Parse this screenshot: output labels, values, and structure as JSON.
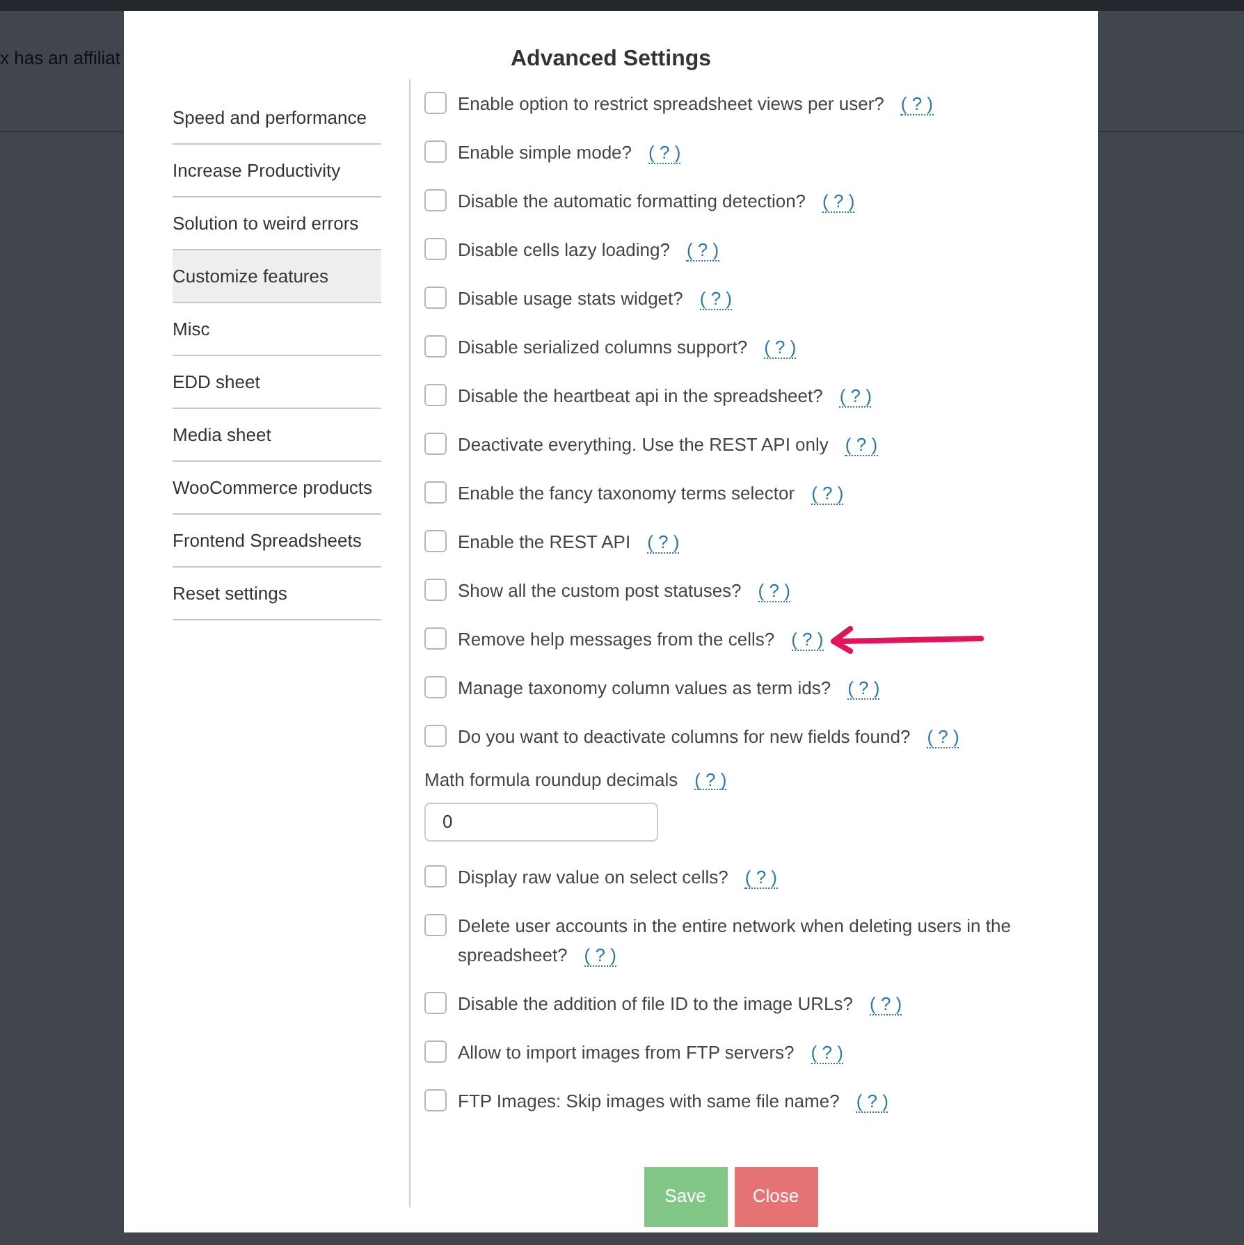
{
  "background": {
    "text": "x has an affiliat"
  },
  "dialog": {
    "title": "Advanced Settings",
    "sidebar": {
      "items": [
        {
          "label": "Speed and performance",
          "selected": false
        },
        {
          "label": "Increase Productivity",
          "selected": false
        },
        {
          "label": "Solution to weird errors",
          "selected": false
        },
        {
          "label": "Customize features",
          "selected": true
        },
        {
          "label": "Misc",
          "selected": false
        },
        {
          "label": "EDD sheet",
          "selected": false
        },
        {
          "label": "Media sheet",
          "selected": false
        },
        {
          "label": "WooCommerce products",
          "selected": false
        },
        {
          "label": "Frontend Spreadsheets",
          "selected": false
        },
        {
          "label": "Reset settings",
          "selected": false
        }
      ]
    },
    "options": [
      {
        "kind": "checkbox",
        "label": "Enable option to restrict spreadsheet views per user?",
        "help": "( ? )",
        "checked": false
      },
      {
        "kind": "checkbox",
        "label": "Enable simple mode?",
        "help": "( ? )",
        "checked": false
      },
      {
        "kind": "checkbox",
        "label": "Disable the automatic formatting detection?",
        "help": "( ? )",
        "checked": false
      },
      {
        "kind": "checkbox",
        "label": "Disable cells lazy loading?",
        "help": "( ? )",
        "checked": false
      },
      {
        "kind": "checkbox",
        "label": "Disable usage stats widget?",
        "help": "( ? )",
        "checked": false
      },
      {
        "kind": "checkbox",
        "label": "Disable serialized columns support?",
        "help": "( ? )",
        "checked": false
      },
      {
        "kind": "checkbox",
        "label": "Disable the heartbeat api in the spreadsheet?",
        "help": "( ? )",
        "checked": false
      },
      {
        "kind": "checkbox",
        "label": "Deactivate everything. Use the REST API only",
        "help": "( ? )",
        "checked": false
      },
      {
        "kind": "checkbox",
        "label": "Enable the fancy taxonomy terms selector",
        "help": "( ? )",
        "checked": false
      },
      {
        "kind": "checkbox",
        "label": "Enable the REST API",
        "help": "( ? )",
        "checked": false
      },
      {
        "kind": "checkbox",
        "label": "Show all the custom post statuses?",
        "help": "( ? )",
        "checked": false
      },
      {
        "kind": "checkbox",
        "label": "Remove help messages from the cells?",
        "help": "( ? )",
        "checked": false,
        "pointed": true
      },
      {
        "kind": "checkbox",
        "label": "Manage taxonomy column values as term ids?",
        "help": "( ? )",
        "checked": false
      },
      {
        "kind": "checkbox",
        "label": "Do you want to deactivate columns for new fields found?",
        "help": "( ? )",
        "checked": false
      },
      {
        "kind": "number",
        "label": "Math formula roundup decimals",
        "help": "( ? )",
        "value": "0"
      },
      {
        "kind": "checkbox",
        "label": "Display raw value on select cells?",
        "help": "( ? )",
        "checked": false
      },
      {
        "kind": "checkbox",
        "label": "Delete user accounts in the entire network when deleting users in the spreadsheet?",
        "help": "( ? )",
        "checked": false
      },
      {
        "kind": "checkbox",
        "label": "Disable the addition of file ID to the image URLs?",
        "help": "( ? )",
        "checked": false
      },
      {
        "kind": "checkbox",
        "label": "Allow to import images from FTP servers?",
        "help": "( ? )",
        "checked": false
      },
      {
        "kind": "checkbox",
        "label": "FTP Images: Skip images with same file name?",
        "help": "( ? )",
        "checked": false
      }
    ],
    "buttons": [
      {
        "kind": "save",
        "label": "Save"
      },
      {
        "kind": "close",
        "label": "Close"
      }
    ]
  }
}
